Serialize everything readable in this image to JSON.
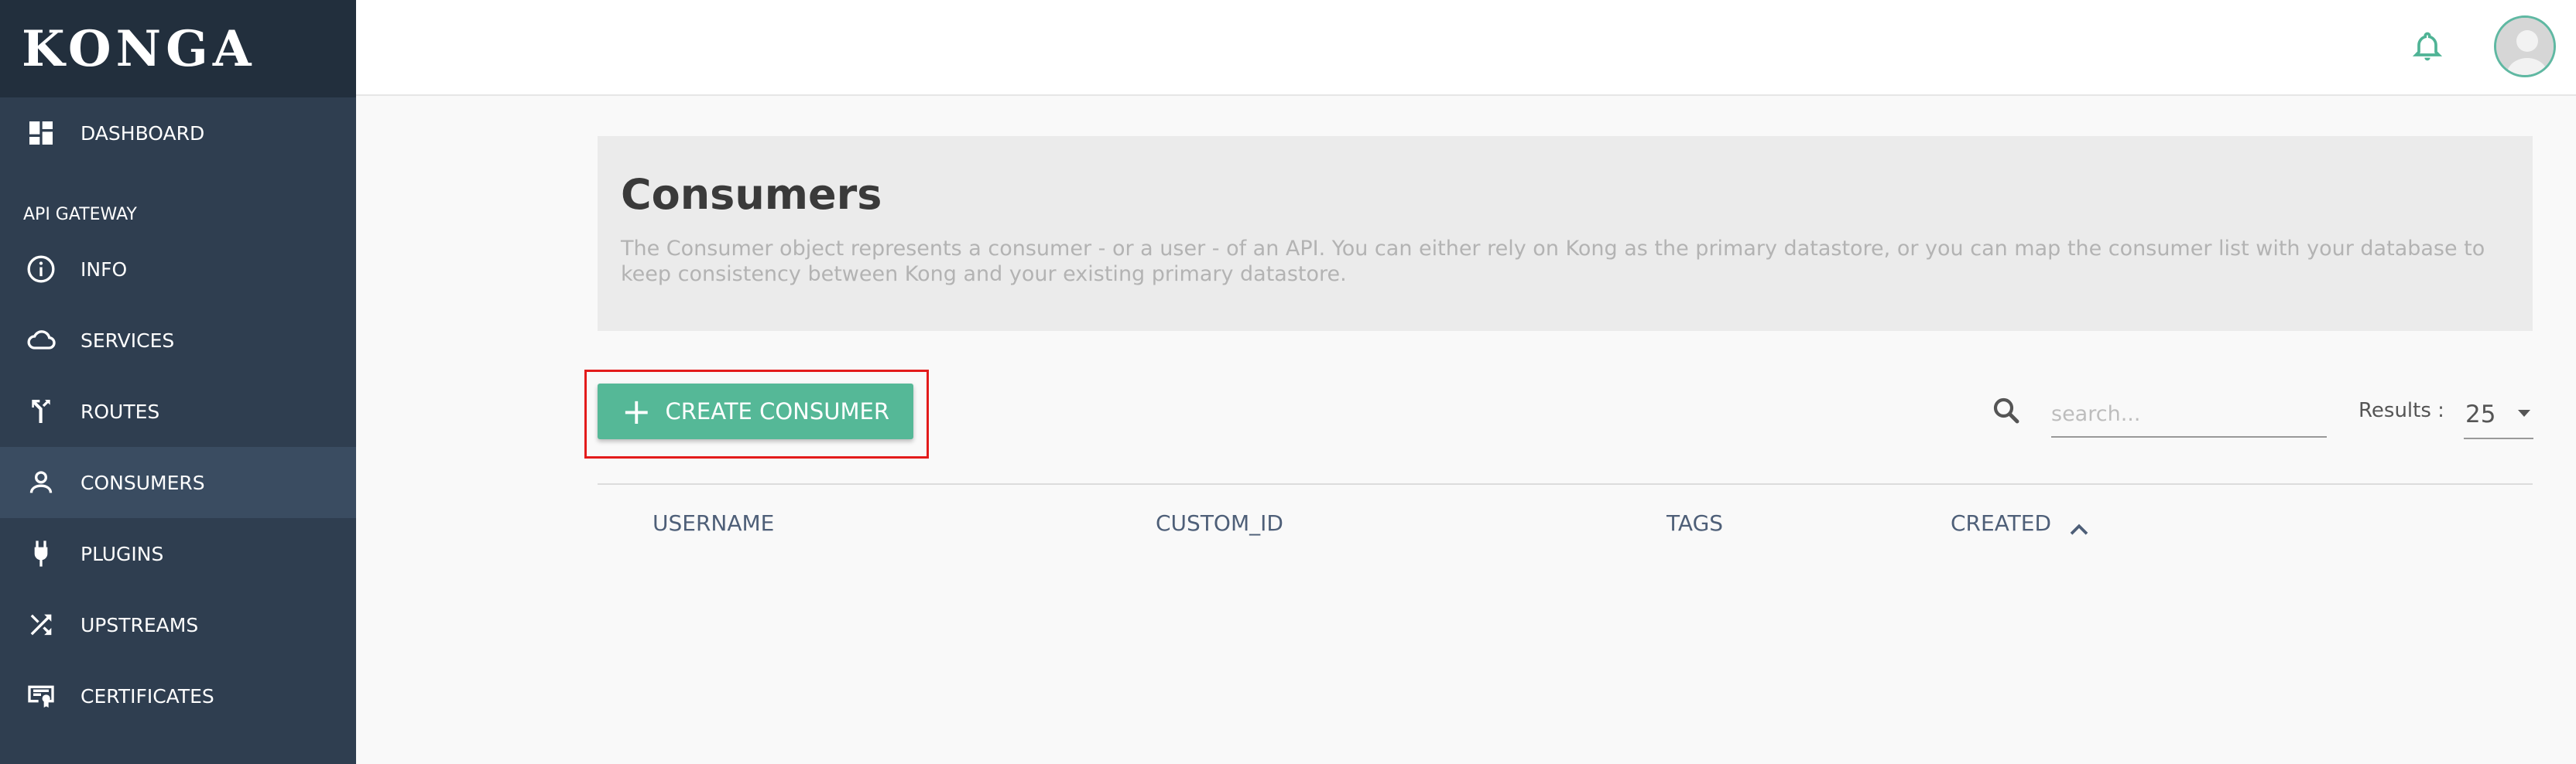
{
  "app": {
    "brand": "KONGA"
  },
  "sidebar": {
    "dashboard": "DASHBOARD",
    "section_label": "API GATEWAY",
    "items": [
      {
        "label": "INFO",
        "icon": "info-icon"
      },
      {
        "label": "SERVICES",
        "icon": "cloud-icon"
      },
      {
        "label": "ROUTES",
        "icon": "routes-icon"
      },
      {
        "label": "CONSUMERS",
        "icon": "person-icon",
        "active": true
      },
      {
        "label": "PLUGINS",
        "icon": "plug-icon"
      },
      {
        "label": "UPSTREAMS",
        "icon": "shuffle-icon"
      },
      {
        "label": "CERTIFICATES",
        "icon": "certificate-icon"
      }
    ]
  },
  "topbar": {
    "bell_icon": "bell-icon",
    "avatar_icon": "avatar-icon"
  },
  "header": {
    "title": "Consumers",
    "description": "The Consumer object represents a consumer - or a user - of an API. You can either rely on Kong as the primary datastore, or you can map the consumer list with your database to keep consistency between Kong and your existing primary datastore."
  },
  "toolbar": {
    "create_label": "CREATE CONSUMER",
    "search_placeholder": "search...",
    "results_label": "Results :",
    "results_value": "25"
  },
  "table": {
    "columns": [
      "USERNAME",
      "CUSTOM_ID",
      "TAGS",
      "CREATED"
    ]
  },
  "colors": {
    "accent": "#55b897",
    "sidebar": "#2f3e50",
    "highlight": "#e31b1b"
  }
}
